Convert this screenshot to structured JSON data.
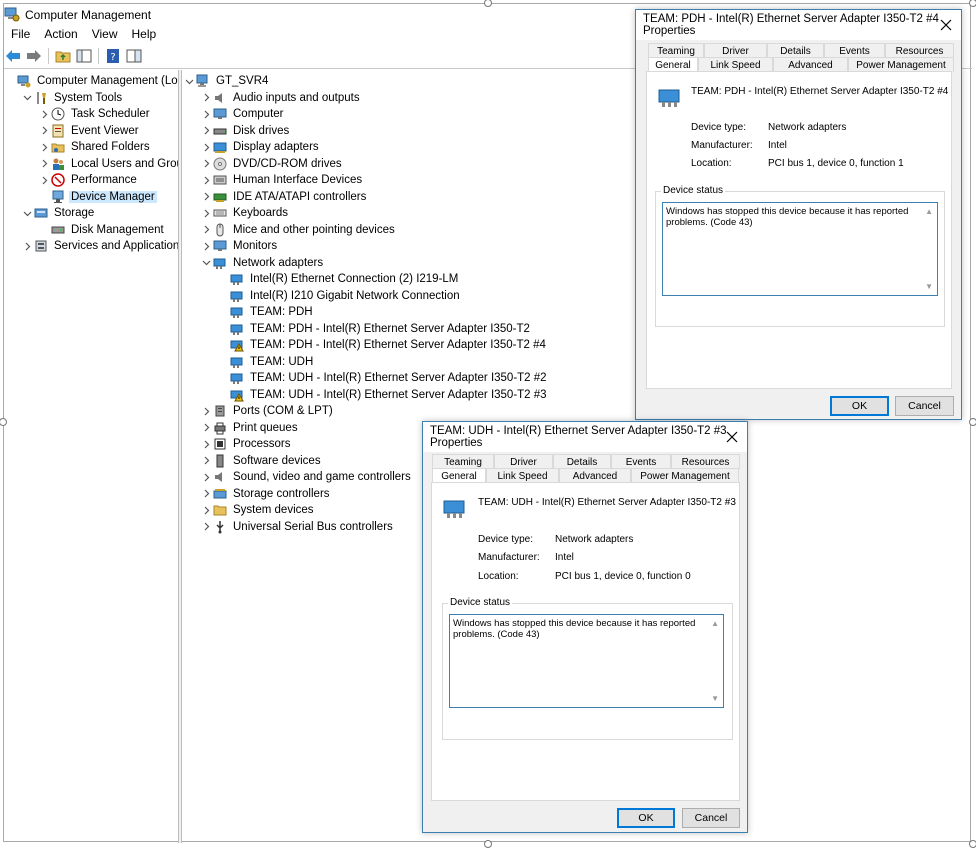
{
  "window": {
    "title": "Computer Management"
  },
  "menu": [
    "File",
    "Action",
    "View",
    "Help"
  ],
  "left_tree": [
    {
      "label": "Computer Management (Local",
      "level": 0,
      "chev": "",
      "icon": "computer-management-icon"
    },
    {
      "label": "System Tools",
      "level": 1,
      "chev": "v",
      "icon": "system-tools-icon"
    },
    {
      "label": "Task Scheduler",
      "level": 2,
      "chev": ">",
      "icon": "clock-icon"
    },
    {
      "label": "Event Viewer",
      "level": 2,
      "chev": ">",
      "icon": "event-viewer-icon"
    },
    {
      "label": "Shared Folders",
      "level": 2,
      "chev": ">",
      "icon": "shared-folder-icon"
    },
    {
      "label": "Local Users and Groups",
      "level": 2,
      "chev": ">",
      "icon": "users-icon"
    },
    {
      "label": "Performance",
      "level": 2,
      "chev": ">",
      "icon": "performance-icon"
    },
    {
      "label": "Device Manager",
      "level": 2,
      "chev": "",
      "icon": "device-manager-icon",
      "selected": true
    },
    {
      "label": "Storage",
      "level": 1,
      "chev": "v",
      "icon": "storage-icon"
    },
    {
      "label": "Disk Management",
      "level": 2,
      "chev": "",
      "icon": "disk-icon"
    },
    {
      "label": "Services and Applications",
      "level": 1,
      "chev": ">",
      "icon": "services-icon"
    }
  ],
  "device_tree": [
    {
      "label": "GT_SVR4",
      "level": 0,
      "chev": "v",
      "icon": "computer-root-icon"
    },
    {
      "label": "Audio inputs and outputs",
      "level": 1,
      "chev": ">",
      "icon": "speaker-icon"
    },
    {
      "label": "Computer",
      "level": 1,
      "chev": ">",
      "icon": "monitor-icon"
    },
    {
      "label": "Disk drives",
      "level": 1,
      "chev": ">",
      "icon": "disk-drive-icon"
    },
    {
      "label": "Display adapters",
      "level": 1,
      "chev": ">",
      "icon": "display-adapter-icon"
    },
    {
      "label": "DVD/CD-ROM drives",
      "level": 1,
      "chev": ">",
      "icon": "dvd-icon"
    },
    {
      "label": "Human Interface Devices",
      "level": 1,
      "chev": ">",
      "icon": "hid-icon"
    },
    {
      "label": "IDE ATA/ATAPI controllers",
      "level": 1,
      "chev": ">",
      "icon": "ide-icon"
    },
    {
      "label": "Keyboards",
      "level": 1,
      "chev": ">",
      "icon": "keyboard-icon"
    },
    {
      "label": "Mice and other pointing devices",
      "level": 1,
      "chev": ">",
      "icon": "mouse-icon"
    },
    {
      "label": "Monitors",
      "level": 1,
      "chev": ">",
      "icon": "monitor-icon"
    },
    {
      "label": "Network adapters",
      "level": 1,
      "chev": "v",
      "icon": "network-adapter-icon"
    },
    {
      "label": "Intel(R) Ethernet Connection (2) I219-LM",
      "level": 2,
      "chev": "",
      "icon": "network-adapter-icon"
    },
    {
      "label": "Intel(R) I210 Gigabit Network Connection",
      "level": 2,
      "chev": "",
      "icon": "network-adapter-icon"
    },
    {
      "label": "TEAM: PDH",
      "level": 2,
      "chev": "",
      "icon": "network-adapter-icon"
    },
    {
      "label": "TEAM: PDH - Intel(R) Ethernet Server Adapter I350-T2",
      "level": 2,
      "chev": "",
      "icon": "network-adapter-icon"
    },
    {
      "label": "TEAM: PDH - Intel(R) Ethernet Server Adapter I350-T2 #4",
      "level": 2,
      "chev": "",
      "icon": "network-adapter-warning-icon"
    },
    {
      "label": "TEAM: UDH",
      "level": 2,
      "chev": "",
      "icon": "network-adapter-icon"
    },
    {
      "label": "TEAM: UDH - Intel(R) Ethernet Server Adapter I350-T2 #2",
      "level": 2,
      "chev": "",
      "icon": "network-adapter-icon"
    },
    {
      "label": "TEAM: UDH - Intel(R) Ethernet Server Adapter I350-T2 #3",
      "level": 2,
      "chev": "",
      "icon": "network-adapter-warning-icon"
    },
    {
      "label": "Ports (COM & LPT)",
      "level": 1,
      "chev": ">",
      "icon": "port-icon"
    },
    {
      "label": "Print queues",
      "level": 1,
      "chev": ">",
      "icon": "printer-icon"
    },
    {
      "label": "Processors",
      "level": 1,
      "chev": ">",
      "icon": "processor-icon"
    },
    {
      "label": "Software devices",
      "level": 1,
      "chev": ">",
      "icon": "software-device-icon"
    },
    {
      "label": "Sound, video and game controllers",
      "level": 1,
      "chev": ">",
      "icon": "speaker-icon"
    },
    {
      "label": "Storage controllers",
      "level": 1,
      "chev": ">",
      "icon": "storage-controller-icon"
    },
    {
      "label": "System devices",
      "level": 1,
      "chev": ">",
      "icon": "system-device-icon"
    },
    {
      "label": "Universal Serial Bus controllers",
      "level": 1,
      "chev": ">",
      "icon": "usb-icon"
    }
  ],
  "dialog_pdh": {
    "title": "TEAM: PDH - Intel(R) Ethernet Server Adapter I350-T2 #4 Properties",
    "tabs_back": [
      "Teaming",
      "Driver",
      "Details",
      "Events",
      "Resources"
    ],
    "tabs_front": [
      "General",
      "Link Speed",
      "Advanced",
      "Power Management"
    ],
    "device_name": "TEAM: PDH - Intel(R) Ethernet Server Adapter I350-T2 #4",
    "device_type_label": "Device type:",
    "device_type": "Network adapters",
    "manufacturer_label": "Manufacturer:",
    "manufacturer": "Intel",
    "location_label": "Location:",
    "location": "PCI bus 1, device 0, function 1",
    "status_label": "Device status",
    "status_text": "Windows has stopped this device because it has reported problems. (Code 43)",
    "ok": "OK",
    "cancel": "Cancel"
  },
  "dialog_udh": {
    "title": "TEAM: UDH - Intel(R) Ethernet Server Adapter I350-T2 #3 Properties",
    "tabs_back": [
      "Teaming",
      "Driver",
      "Details",
      "Events",
      "Resources"
    ],
    "tabs_front": [
      "General",
      "Link Speed",
      "Advanced",
      "Power Management"
    ],
    "device_name": "TEAM: UDH - Intel(R) Ethernet Server Adapter I350-T2 #3",
    "device_type_label": "Device type:",
    "device_type": "Network adapters",
    "manufacturer_label": "Manufacturer:",
    "manufacturer": "Intel",
    "location_label": "Location:",
    "location": "PCI bus 1, device 0, function 0",
    "status_label": "Device status",
    "status_text": "Windows has stopped this device because it has reported problems. (Code 43)",
    "ok": "OK",
    "cancel": "Cancel"
  },
  "colors": {
    "selection": "#cce8ff",
    "accent": "#0078d7",
    "dialog_border": "#3c7fb1"
  }
}
